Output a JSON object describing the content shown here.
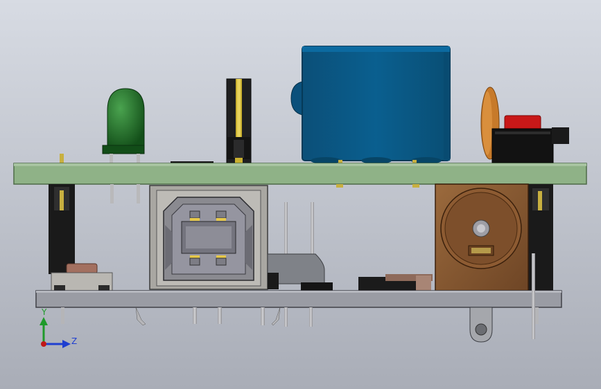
{
  "viewport": {
    "background_top": "#d7dbe3",
    "background_bottom": "#a9adb7"
  },
  "triad": {
    "y_label": "Y",
    "z_label": "Z",
    "y_color": "#1f9a2a",
    "z_color": "#1f3fd0",
    "x_color": "#c01818"
  },
  "colors": {
    "pcb_green": "#8fb287",
    "pcb_gray": "#9a9ca4",
    "led_green": "#1d6b24",
    "blue_part": "#0a5a86",
    "brown_jack": "#8a5a32",
    "orange_cap": "#c77a2a",
    "red_button": "#c81818",
    "usb_shell": "#a9a7a2"
  },
  "components": [
    {
      "name": "green-led"
    },
    {
      "name": "pin-header"
    },
    {
      "name": "blue-capacitor"
    },
    {
      "name": "ceramic-capacitor"
    },
    {
      "name": "tactile-switch"
    },
    {
      "name": "usb-b-connector"
    },
    {
      "name": "dc-power-jack"
    },
    {
      "name": "voltage-regulator"
    },
    {
      "name": "slide-switch"
    }
  ]
}
